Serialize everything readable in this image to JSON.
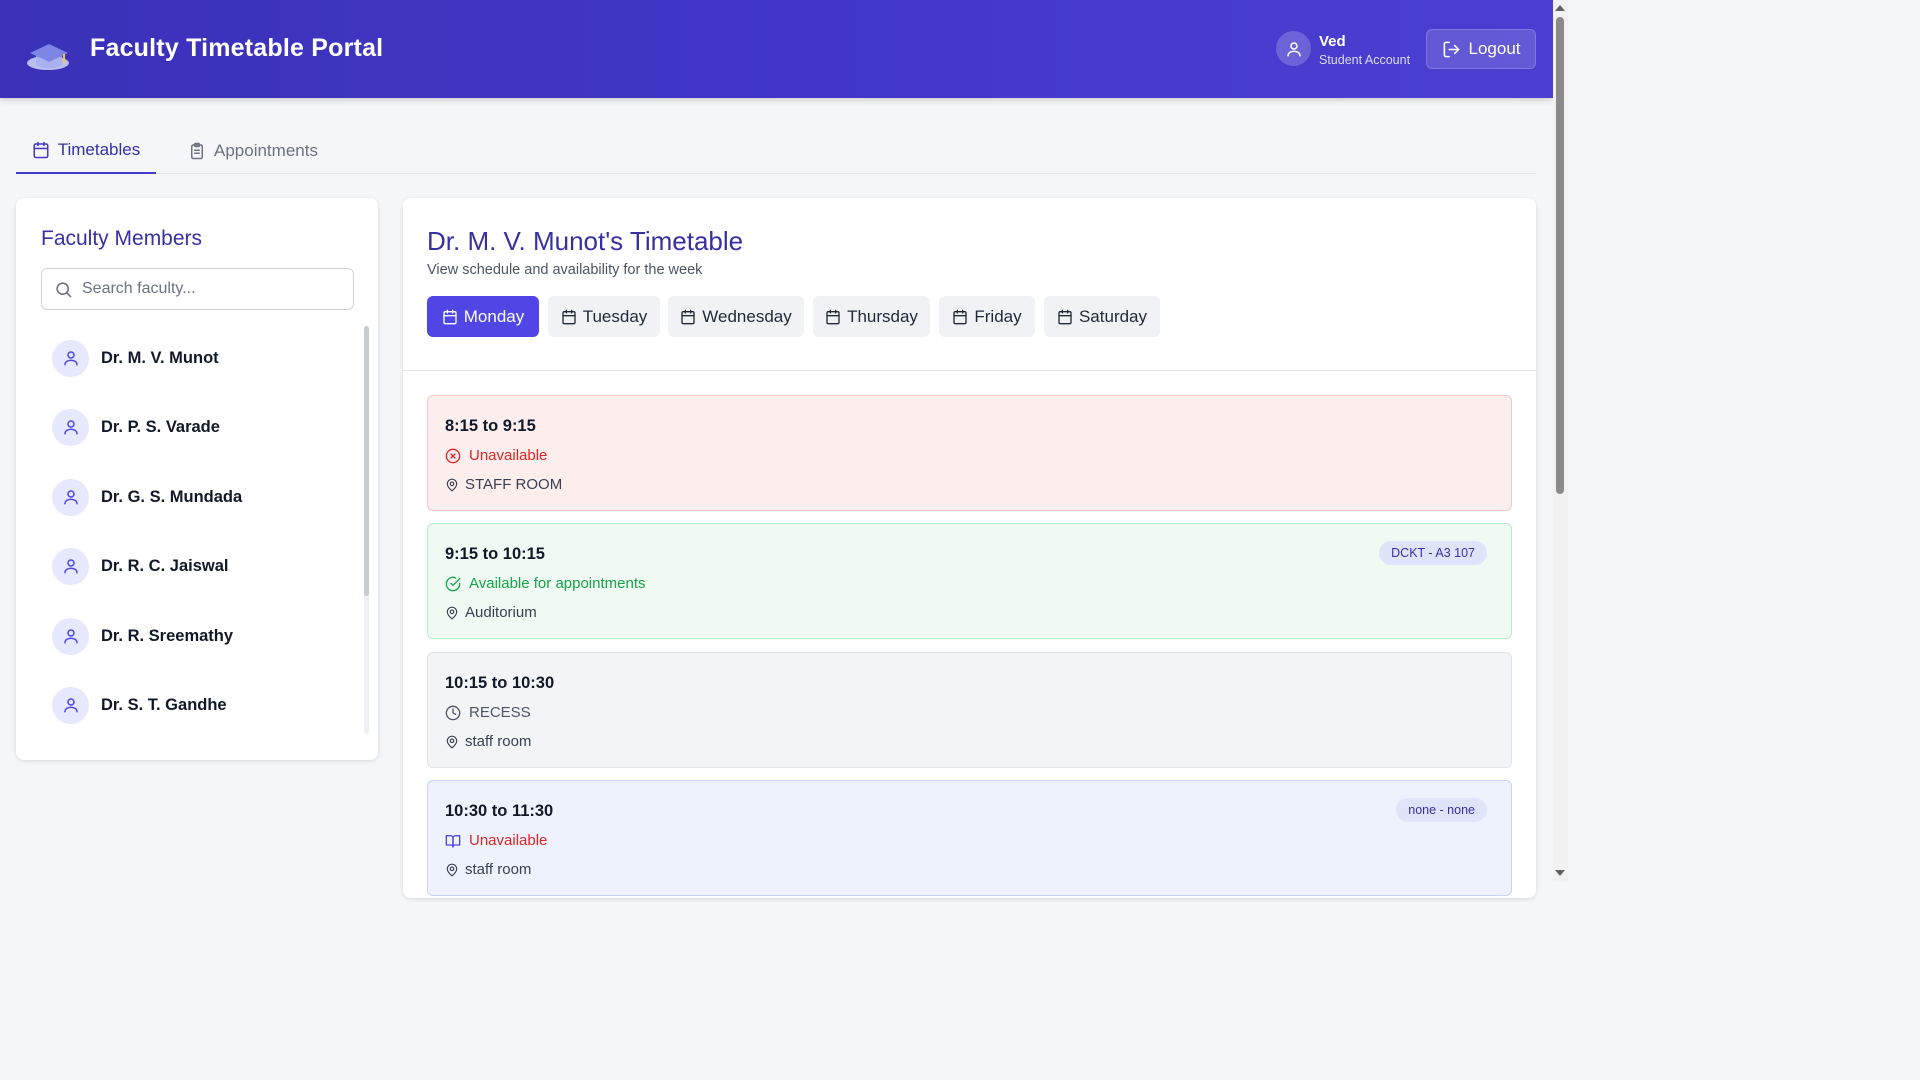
{
  "header": {
    "app_title": "Faculty Timetable Portal",
    "user_name": "Ved",
    "user_role": "Student Account",
    "logout_label": "Logout"
  },
  "tabs": [
    {
      "label": "Timetables",
      "icon": "calendar-icon",
      "active": true
    },
    {
      "label": "Appointments",
      "icon": "clipboard-icon",
      "active": false
    }
  ],
  "sidebar": {
    "title": "Faculty Members",
    "search_placeholder": "Search faculty...",
    "faculty": [
      {
        "name": "Dr. M. V. Munot"
      },
      {
        "name": "Dr. P. S. Varade"
      },
      {
        "name": "Dr. G. S. Mundada"
      },
      {
        "name": "Dr. R. C. Jaiswal"
      },
      {
        "name": "Dr. R. Sreemathy"
      },
      {
        "name": "Dr. S. T. Gandhe"
      }
    ]
  },
  "timetable": {
    "title": "Dr. M. V. Munot's Timetable",
    "subtitle": "View schedule and availability for the week",
    "days": [
      "Monday",
      "Tuesday",
      "Wednesday",
      "Thursday",
      "Friday",
      "Saturday"
    ],
    "selected_day": "Monday",
    "slots": [
      {
        "time": "8:15 to 9:15",
        "status": "Unavailable",
        "status_icon": "x-circle-icon",
        "location": "STAFF ROOM",
        "badge": ""
      },
      {
        "time": "9:15 to 10:15",
        "status": "Available for appointments",
        "status_icon": "check-circle-icon",
        "location": "Auditorium",
        "badge": "DCKT - A3 107"
      },
      {
        "time": "10:15 to 10:30",
        "status": "RECESS",
        "status_icon": "clock-icon",
        "location": "staff room",
        "badge": ""
      },
      {
        "time": "10:30 to 11:30",
        "status": "Unavailable",
        "status_icon": "book-icon",
        "location": "staff room",
        "badge": "none - none"
      }
    ]
  },
  "colors": {
    "header": "#4338ca",
    "accent": "#4f46e5",
    "title": "#3730a3",
    "unavailable": "#dc2626",
    "available": "#16a34a"
  }
}
